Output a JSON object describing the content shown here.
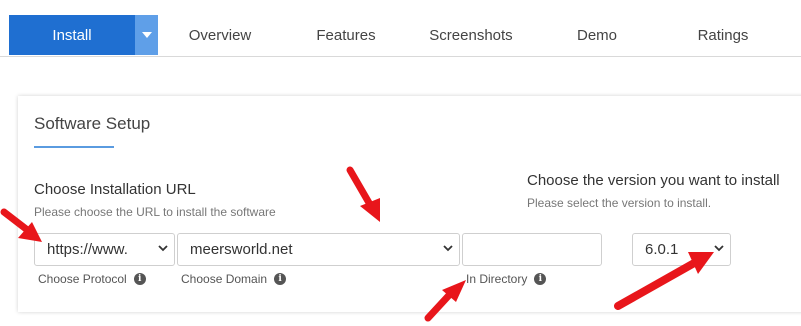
{
  "tabs": {
    "install": "Install",
    "overview": "Overview",
    "features": "Features",
    "screenshots": "Screenshots",
    "demo": "Demo",
    "ratings": "Ratings"
  },
  "setup": {
    "title": "Software Setup",
    "install_url": {
      "heading": "Choose Installation URL",
      "subtext": "Please choose the URL to install the software",
      "protocol_value": "https://www.",
      "protocol_caption": "Choose Protocol",
      "domain_value": "meersworld.net",
      "domain_caption": "Choose Domain",
      "directory_value": "",
      "directory_caption": "In Directory"
    },
    "version": {
      "heading": "Choose the version you want to install",
      "subtext": "Please select the version to install.",
      "value": "6.0.1"
    }
  },
  "colors": {
    "install_button": "#1f6fd1",
    "annotation_arrow": "#e8161b",
    "accent_underline": "#5a9be0"
  },
  "icons": [
    "caret-down-icon",
    "chevron-down-icon",
    "info-icon",
    "red-arrow-annotation"
  ]
}
